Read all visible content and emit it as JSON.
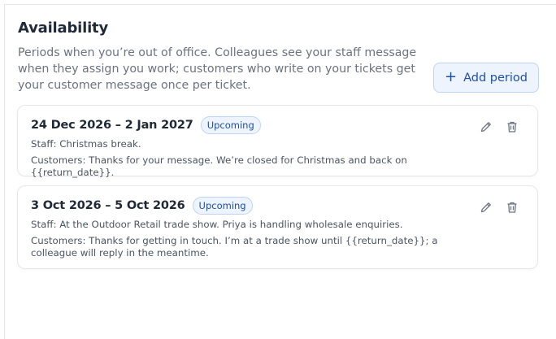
{
  "availability": {
    "title": "Availability",
    "description": "Periods when you’re out of office. Colleagues see your staff message when they assign you work; customers who write on your tickets get your customer message once per ticket.",
    "add_button": {
      "icon": "+",
      "label": "Add period"
    },
    "periods": [
      {
        "range": "24 Dec 2026 – 2 Jan 2027",
        "status": "Upcoming",
        "staff": "Staff: Christmas break.",
        "customers": "Customers: Thanks for your message. We’re closed for Christmas and back on {{return_date}}."
      },
      {
        "range": "3 Oct 2026 – 5 Oct 2026",
        "status": "Upcoming",
        "staff": "Staff: At the Outdoor Retail trade show. Priya is handling wholesale enquiries.",
        "customers": "Customers: Thanks for getting in touch. I’m at a trade show until {{return_date}}; a colleague will reply in the meantime."
      }
    ],
    "icons": {
      "edit": "pencil-icon",
      "delete": "trash-icon"
    },
    "colors": {
      "accent": "#1e4fa8",
      "accent_bg": "#eef4fd",
      "accent_border": "#bfd3f2"
    }
  }
}
